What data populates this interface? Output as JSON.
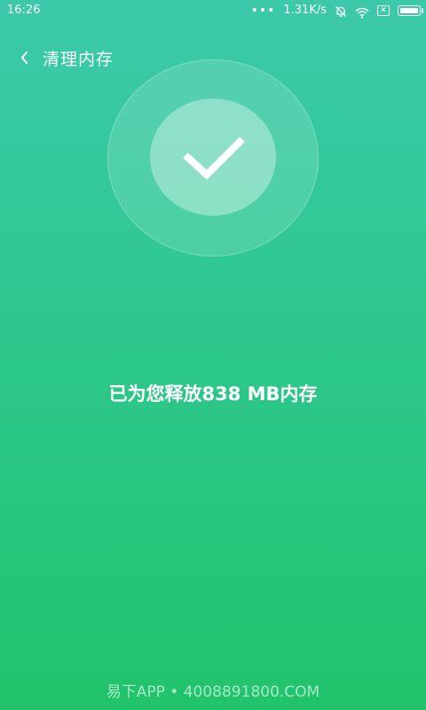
{
  "status_bar": {
    "time": "16:26",
    "dots": "•••",
    "speed": "1.31K/s",
    "sim_mark": "✕",
    "icons": [
      "notifications-off-icon",
      "wifi-icon",
      "sim-x-icon",
      "battery-icon"
    ]
  },
  "header": {
    "back_icon": "chevron-left-icon",
    "title": "清理内存"
  },
  "result": {
    "status_icon": "checkmark-icon",
    "message": "已为您释放838 MB内存"
  },
  "watermark": {
    "text": "易下APP • 4008891800.COM"
  },
  "colors": {
    "gradient_top": "#3cc9aa",
    "gradient_bottom": "#22c36c",
    "text": "#ffffff"
  }
}
